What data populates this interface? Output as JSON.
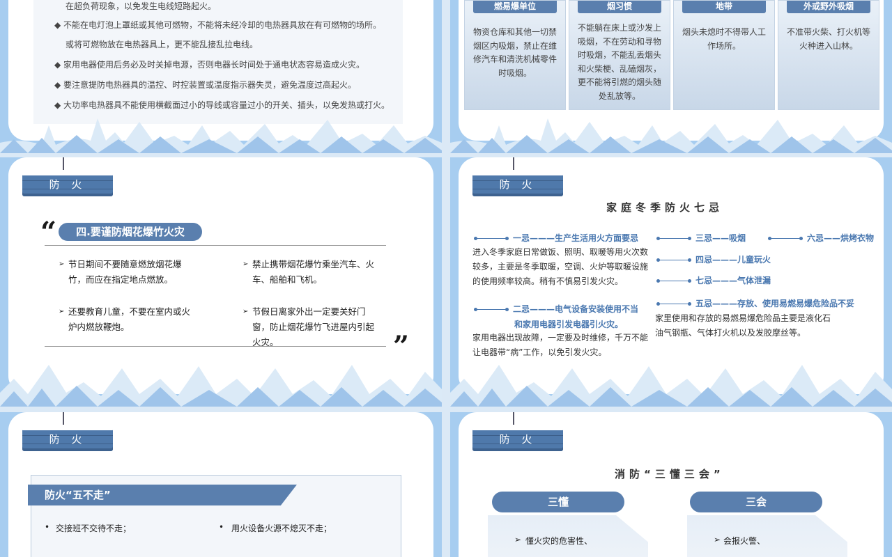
{
  "slide1": {
    "lines": [
      "在超负荷现象，以免发生电线短路起火。",
      "◆ 不能在电灯泡上罩纸或其他可燃物，不能将未经冷却的电热器具放在有可燃物的场所。",
      "或将可燃物放在电热器具上，更不能乱接乱拉电线。",
      "◆ 家用电器使用后务必及时关掉电源，否则电器长时间处于通电状态容易造成火灾。",
      "◆   要注意提防电热器具的温控、时控装置或温度指示器失灵，避免温度过高起火。",
      "◆ 大功率电热器具不能使用横截面过小的导线或容量过小的开关、插头，以免发热或打火。"
    ]
  },
  "slide2": {
    "cols": [
      {
        "title": "燃易爆单位",
        "body": "物资仓库和其他一切禁烟区内吸烟，禁止在维修汽车和清洗机械零件时吸烟。"
      },
      {
        "title": "烟习惯",
        "body": "不能躺在床上或沙发上吸烟，不在劳动和寻物时吸烟，不能乱丢烟头和火柴梗、乱磕烟灰，更不能将引燃的烟头随处乱放等。"
      },
      {
        "title": "地带",
        "body": "烟头未熄时不得带人工作场所。"
      },
      {
        "title": "外或野外吸烟",
        "body": "不准带火柴、打火机等火种进入山林。"
      }
    ]
  },
  "sign_label": "防 火",
  "slide3": {
    "heading": "四.要谨防烟花爆竹火灾",
    "open_quote": "“",
    "close_quote": "”",
    "bullets": [
      "节日期间不要随意燃放烟花爆竹，而应在指定地点燃放。",
      "禁止携带烟花爆竹乘坐汽车、火车、船舶和飞机。",
      "还要教育儿童，不要在室内或火炉内燃放鞭炮。",
      "节假日离家外出一定要关好门窗，防止烟花爆竹飞进屋内引起火灾。"
    ],
    "arrow": "➢"
  },
  "slide4": {
    "title": "家庭冬季防火七忌",
    "item1": "一忌———生产生活用火方面要忌",
    "para1": "进入冬季家庭日常做饭、照明、取暖等用火次数较多，主要是冬季取暖，空调、火炉等取暖设施的使用频率较高。稍有不慎易引发火灾。",
    "item2a": "二忌———电气设备安装使用不当",
    "item2b": "和家用电器引发电器引火灾。",
    "para2": "家用电器出现故障，一定要及时维修，千万不能让电器带“病”工作，以免引发火灾。",
    "item3": "三忌——吸烟",
    "item6": "六忌——烘烤衣物",
    "item4": "四忌———儿童玩火",
    "item7": "七忌———气体泄漏",
    "item5": "五忌———存放、使用易燃易爆危险品不妥",
    "para5": "家里使用和存放的易燃易爆危险品主要是液化石油气钢瓶、气体打火机以及发胶摩丝等。"
  },
  "slide5": {
    "banner": "防火“五不走”",
    "left1": "交接班不交待不走；",
    "right1": "用火设备火源不熄灭不走；",
    "dot": "•"
  },
  "slide6": {
    "title": "消防“三懂三会”",
    "tab_left": "三懂",
    "tab_right": "三会",
    "left_item": "懂火灾的危害性、",
    "right_item": "会报火警、",
    "arrow": "➢"
  },
  "colors": {
    "accent": "#5a7fae",
    "frame": "#a7cdf0",
    "item_blue": "#4a78b0"
  }
}
